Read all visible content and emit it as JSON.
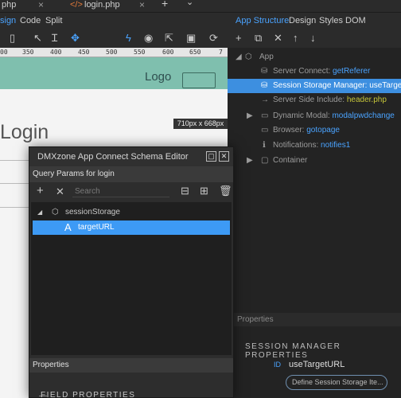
{
  "tabs": [
    {
      "label": "php",
      "close": "×"
    },
    {
      "label": "login.php",
      "close": "×"
    }
  ],
  "tabbar": {
    "add": "+",
    "dropdown": "⌄"
  },
  "modes": {
    "left": [
      "sign",
      "Code",
      "Split"
    ],
    "right": [
      "App Structure",
      "Design",
      "Styles",
      "DOM"
    ]
  },
  "ruler": {
    "labels": [
      "00",
      "350",
      "400",
      "450",
      "500",
      "550",
      "600",
      "650",
      "7"
    ]
  },
  "canvas": {
    "logo": "Logo",
    "size_badge": "710px x 668px",
    "title": "Login"
  },
  "app_structure": {
    "root": "App",
    "items": [
      {
        "label": "Server Connect: ",
        "value": "getReferer",
        "value_style": "blue",
        "icon": "database-icon",
        "selected": false
      },
      {
        "label": "Session Storage Manager: ",
        "value": "useTargetURL",
        "value_style": "blue",
        "icon": "database-icon",
        "selected": true
      },
      {
        "label": "Server Side Include: ",
        "value": "header.php",
        "value_style": "yellow",
        "icon": "arrow-icon",
        "selected": false
      },
      {
        "label": "Dynamic Modal: ",
        "value": "modalpwdchange",
        "value_style": "blue",
        "icon": "modal-icon",
        "selected": false
      },
      {
        "label": "Browser: ",
        "value": "gotopage",
        "value_style": "blue",
        "icon": "browser-icon",
        "selected": false
      },
      {
        "label": "Notifications: ",
        "value": "notifies1",
        "value_style": "blue",
        "icon": "info-icon",
        "selected": false
      },
      {
        "label": "Container",
        "value": "",
        "value_style": "blue",
        "icon": "container-icon",
        "selected": false
      }
    ]
  },
  "properties": {
    "header": "Properties",
    "section_title": "SESSION MANAGER PROPERTIES",
    "id_label": "ID",
    "id_value": "useTargetURL",
    "define_button": "Define Session Storage Ite..."
  },
  "dialog": {
    "title": "DMXzone App Connect Schema Editor",
    "query_params": "Query Params for login",
    "search_placeholder": "Search",
    "tree": [
      {
        "label": "sessionStorage",
        "icon": "storage-icon",
        "selected": false
      },
      {
        "label": "targetURL",
        "icon": "text-icon",
        "selected": true
      }
    ],
    "properties_header": "Properties",
    "field_properties": "FIELD PROPERTIES"
  },
  "colors": {
    "accent": "#3d8fe0",
    "header_green": "#7fbfae",
    "panel_bg": "#232323"
  }
}
